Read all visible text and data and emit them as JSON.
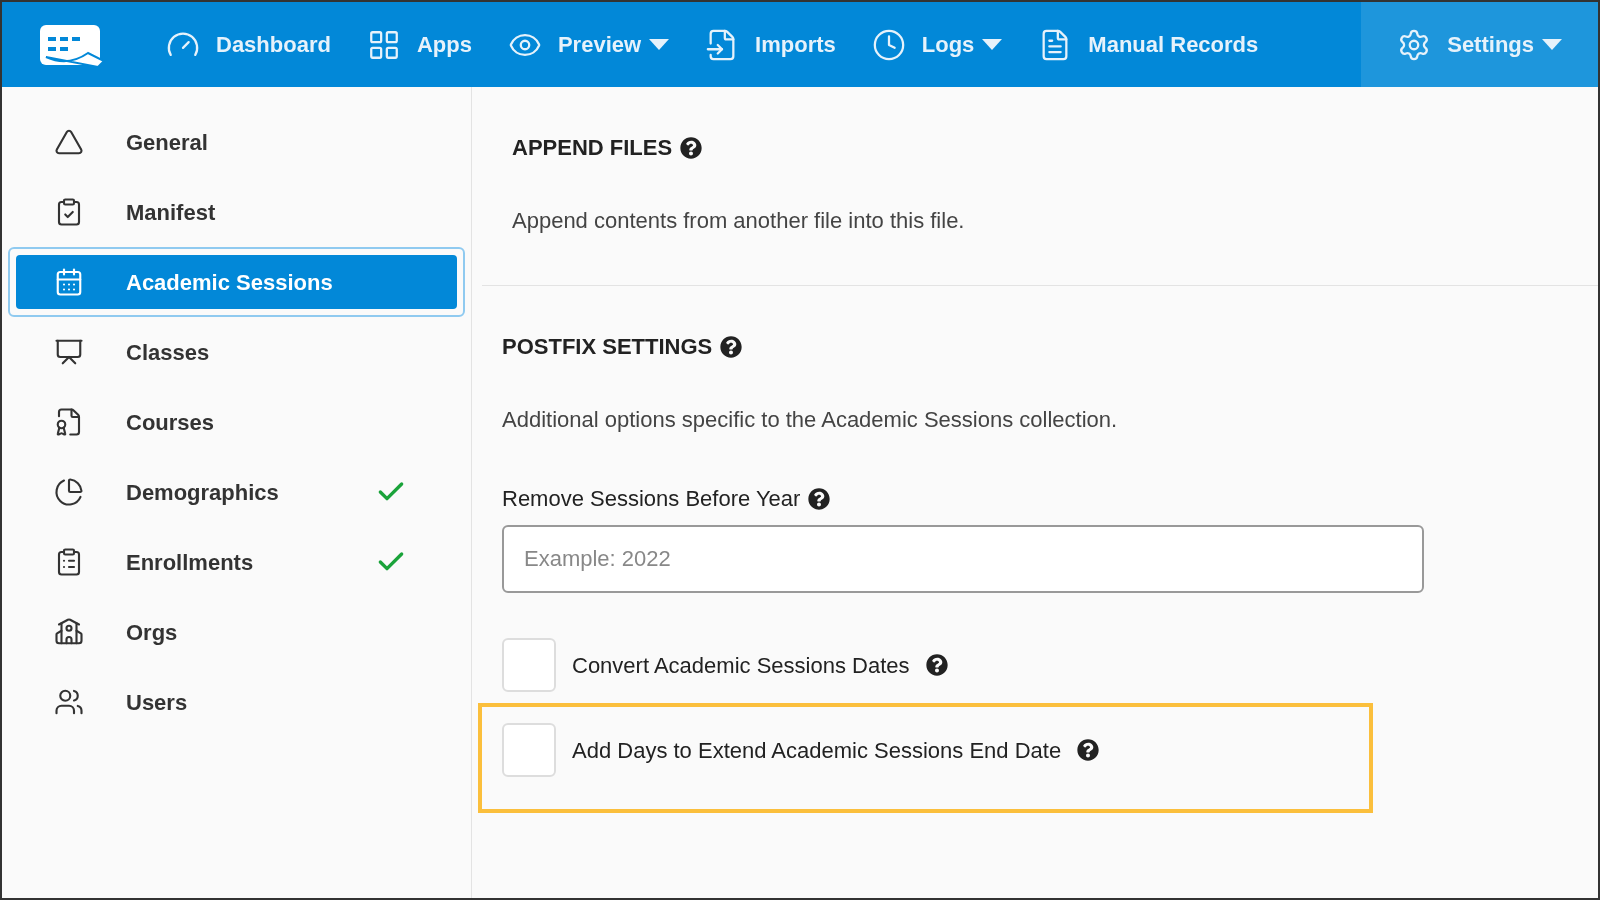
{
  "nav": {
    "items": [
      {
        "label": "Dashboard",
        "dropdown": false,
        "selected": false
      },
      {
        "label": "Apps",
        "dropdown": false,
        "selected": false
      },
      {
        "label": "Preview",
        "dropdown": true,
        "selected": false
      },
      {
        "label": "Imports",
        "dropdown": false,
        "selected": false
      },
      {
        "label": "Logs",
        "dropdown": true,
        "selected": false
      },
      {
        "label": "Manual Records",
        "dropdown": false,
        "selected": false
      },
      {
        "label": "Settings",
        "dropdown": true,
        "selected": true
      }
    ]
  },
  "sidebar": {
    "items": [
      {
        "label": "General",
        "selected": false,
        "done": false
      },
      {
        "label": "Manifest",
        "selected": false,
        "done": false
      },
      {
        "label": "Academic Sessions",
        "selected": true,
        "done": false
      },
      {
        "label": "Classes",
        "selected": false,
        "done": false
      },
      {
        "label": "Courses",
        "selected": false,
        "done": false
      },
      {
        "label": "Demographics",
        "selected": false,
        "done": true
      },
      {
        "label": "Enrollments",
        "selected": false,
        "done": true
      },
      {
        "label": "Orgs",
        "selected": false,
        "done": false
      },
      {
        "label": "Users",
        "selected": false,
        "done": false
      }
    ]
  },
  "sections": [
    {
      "title": "APPEND FILES",
      "description": "Append contents from another file into this file."
    },
    {
      "title": "POSTFIX SETTINGS",
      "description": "Additional options specific to the Academic Sessions collection."
    }
  ],
  "field": {
    "label": "Remove Sessions Before Year",
    "placeholder": "Example: 2022"
  },
  "options": [
    {
      "label": "Convert Academic Sessions Dates",
      "checked": false,
      "highlighted": false
    },
    {
      "label": "Add Days to Extend Academic Sessions End Date",
      "checked": false,
      "highlighted": true
    }
  ]
}
